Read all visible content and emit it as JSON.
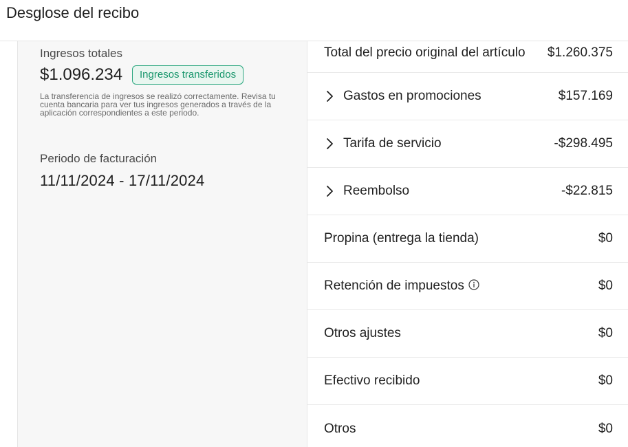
{
  "header": {
    "title": "Desglose del recibo"
  },
  "summary": {
    "total_label": "Ingresos totales",
    "total_amount": "$1.096.234",
    "badge": "Ingresos transferidos",
    "note": "La transferencia de ingresos se realizó correctamente. Revisa tu cuenta bancaria para ver tus ingresos generados a través de la aplicación correspondientes a este periodo.",
    "period_label": "Periodo de facturación",
    "period_value": "11/11/2024 - 17/11/2024"
  },
  "breakdown": {
    "rows": [
      {
        "label": "Total del precio original del artículo",
        "value": "$1.260.375"
      },
      {
        "label": "Gastos en promociones",
        "value": "$157.169"
      },
      {
        "label": "Tarifa de servicio",
        "value": "-$298.495"
      },
      {
        "label": "Reembolso",
        "value": "-$22.815"
      },
      {
        "label": "Propina (entrega la tienda)",
        "value": "$0"
      },
      {
        "label": "Retención de impuestos",
        "value": "$0"
      },
      {
        "label": "Otros ajustes",
        "value": "$0"
      },
      {
        "label": "Efectivo recibido",
        "value": "$0"
      },
      {
        "label": "Otros",
        "value": "$0"
      }
    ]
  },
  "icons": {
    "expand": "chevron-right-icon",
    "info": "info-icon"
  },
  "colors": {
    "badge_text": "#18966c",
    "badge_border": "#2aa77f",
    "badge_bg": "#e9f6f0"
  }
}
